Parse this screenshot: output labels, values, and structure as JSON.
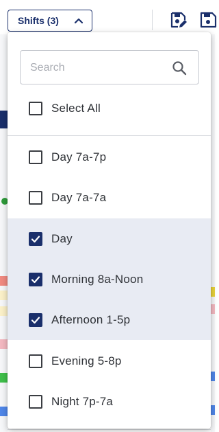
{
  "toolbar": {
    "shifts_button_label": "Shifts (3)",
    "icons": [
      "chevron-up-icon",
      "save-edit-icon",
      "save-icon"
    ]
  },
  "dropdown": {
    "search": {
      "placeholder": "Search",
      "value": "",
      "icon": "search-icon"
    },
    "select_all": {
      "label": "Select All",
      "checked": false
    },
    "options": [
      {
        "label": "Day 7a-7p",
        "checked": false
      },
      {
        "label": "Day 7a-7a",
        "checked": false
      },
      {
        "label": "Day",
        "checked": true
      },
      {
        "label": "Morning 8a-Noon",
        "checked": true
      },
      {
        "label": "Afternoon 1-5p",
        "checked": true
      },
      {
        "label": "Evening 5-8p",
        "checked": false
      },
      {
        "label": "Night 7p-7a",
        "checked": false
      }
    ]
  },
  "colors": {
    "brand_navy": "#1a2f6b",
    "selected_row_bg": "#e8ebf3",
    "checkbox_border": "#3a3d42"
  }
}
